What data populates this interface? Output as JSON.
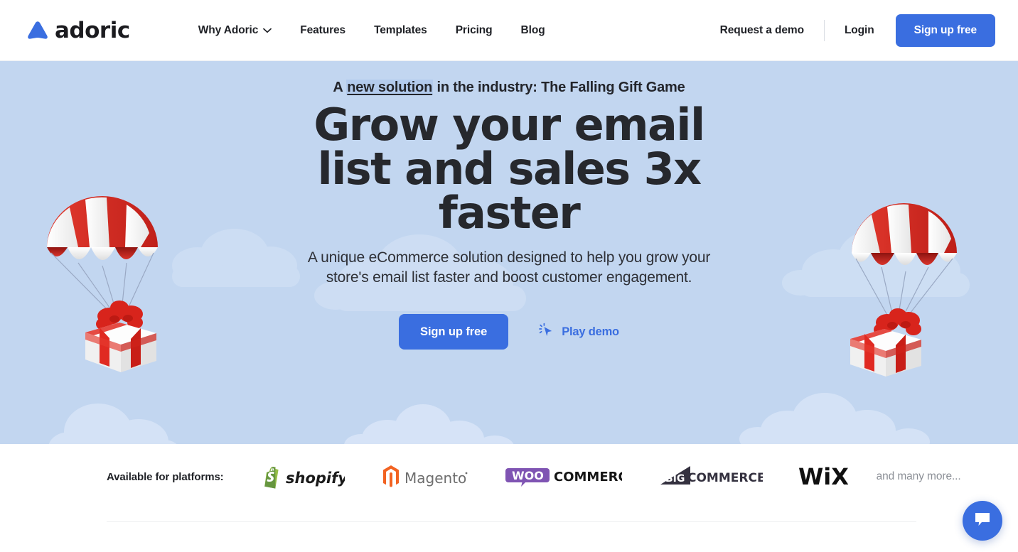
{
  "brand": {
    "name": "adoric",
    "logo_icon": "adoric-triangle-logo",
    "accent_color": "#3a6ee0",
    "hero_bg_color": "#c2d6f0"
  },
  "navbar": {
    "links": [
      {
        "label": "Why Adoric",
        "has_dropdown": true,
        "icon": "chevron-down-icon"
      },
      {
        "label": "Features",
        "has_dropdown": false
      },
      {
        "label": "Templates",
        "has_dropdown": false
      },
      {
        "label": "Pricing",
        "has_dropdown": false
      },
      {
        "label": "Blog",
        "has_dropdown": false
      }
    ],
    "request_demo": "Request a demo",
    "login": "Login",
    "signup": "Sign up free"
  },
  "hero": {
    "eyebrow_before": "A ",
    "eyebrow_highlight": "new solution",
    "eyebrow_after": " in the industry: The Falling Gift Game",
    "title": "Grow your email list and sales 3x faster",
    "subtitle": "A unique eCommerce solution designed to help you grow your store's email list faster and boost customer engagement.",
    "cta_primary": "Sign up free",
    "cta_secondary": "Play demo",
    "cta_secondary_icon": "cursor-click-icon",
    "illustration_left": "parachute-gift-illustration",
    "illustration_right": "parachute-gift-illustration"
  },
  "platforms": {
    "label": "Available for platforms:",
    "items": [
      {
        "name": "Shopify",
        "icon": "shopify-logo"
      },
      {
        "name": "Magento",
        "icon": "magento-logo"
      },
      {
        "name": "WooCommerce",
        "icon": "woocommerce-logo"
      },
      {
        "name": "BigCommerce",
        "icon": "bigcommerce-logo"
      },
      {
        "name": "Wix",
        "icon": "wix-logo"
      }
    ],
    "more": "and many more..."
  },
  "chat": {
    "icon": "chat-bubble-icon",
    "color": "#3a6ee0"
  }
}
